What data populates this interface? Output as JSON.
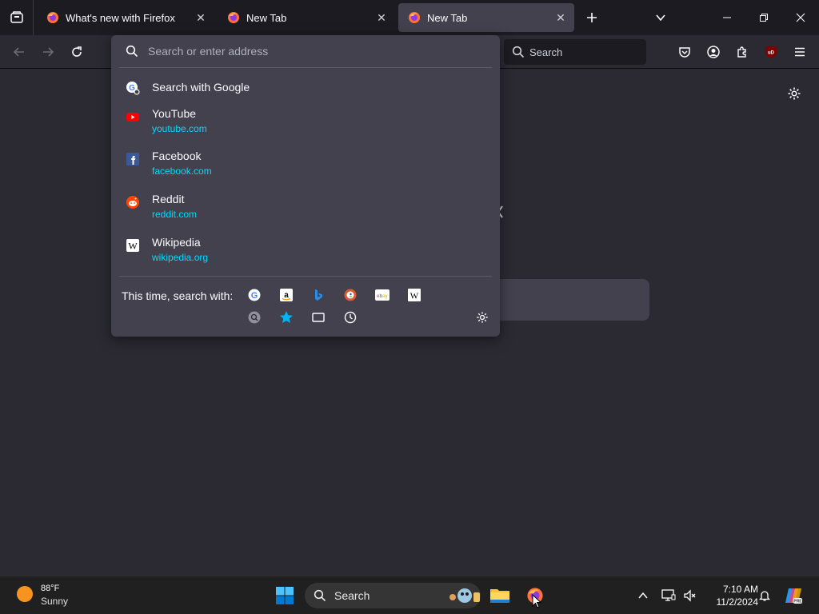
{
  "tabs": [
    {
      "title": "What's new with Firefox",
      "selected": false
    },
    {
      "title": "New Tab",
      "selected": false
    },
    {
      "title": "New Tab",
      "selected": true
    }
  ],
  "toolbar": {
    "search_placeholder": "Search"
  },
  "urlbar": {
    "placeholder": "Search or enter address",
    "results": [
      {
        "title": "Search with Google",
        "url": "",
        "icon": "google-search-icon"
      },
      {
        "title": "YouTube",
        "url": "youtube.com",
        "icon": "youtube-icon"
      },
      {
        "title": "Facebook",
        "url": "facebook.com",
        "icon": "facebook-icon"
      },
      {
        "title": "Reddit",
        "url": "reddit.com",
        "icon": "reddit-icon"
      },
      {
        "title": "Wikipedia",
        "url": "wikipedia.org",
        "icon": "wikipedia-icon"
      }
    ],
    "one_offs_label": "This time, search with:",
    "one_off_engines": [
      "google-icon",
      "amazon-icon",
      "bing-icon",
      "duckduckgo-icon",
      "ebay-icon",
      "wikipedia-icon"
    ],
    "one_off_modes": [
      "search-engine-icon",
      "bookmarks-icon",
      "tabs-icon",
      "history-icon"
    ]
  },
  "taskbar": {
    "weather_temp": "88°F",
    "weather_condition": "Sunny",
    "search_label": "Search",
    "time": "7:10 AM",
    "date": "11/2/2024"
  },
  "colors": {
    "accent": "#00ddff",
    "popup_bg": "#42414d",
    "toolbar_bg": "#2b2a33",
    "tabstrip_bg": "#1c1b22"
  }
}
